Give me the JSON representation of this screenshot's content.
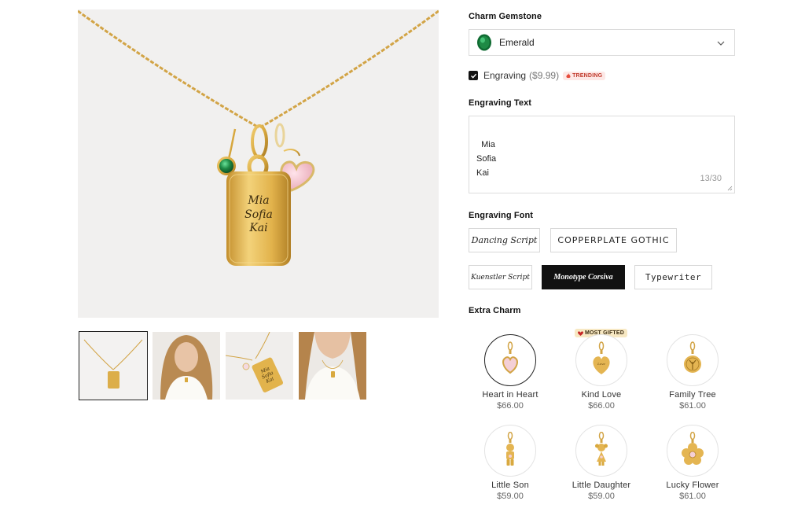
{
  "gallery": {
    "engraving_on_pendant": [
      "Mia",
      "Sofia",
      "Kai"
    ],
    "thumbnails": [
      {
        "name": "necklace-flat"
      },
      {
        "name": "model-wearing-1"
      },
      {
        "name": "necklace-angled"
      },
      {
        "name": "model-wearing-2"
      }
    ]
  },
  "gemstone": {
    "title": "Charm Gemstone",
    "selected": "Emerald",
    "gem_color": "#1e8a45"
  },
  "engraving_option": {
    "label": "Engraving",
    "price": "($9.99)",
    "badge": "TRENDING",
    "checked": true
  },
  "engraving_text": {
    "title": "Engraving Text",
    "value": "Mia\nSofia\nKai",
    "counter": "13/30"
  },
  "engraving_font": {
    "title": "Engraving Font",
    "options": [
      {
        "label": "Dancing Script",
        "selected": false
      },
      {
        "label": "COPPERPLATE GOTHIC",
        "selected": false
      },
      {
        "label": "Kuenstler Script",
        "selected": false
      },
      {
        "label": "Monotype Corsiva",
        "selected": true
      },
      {
        "label": "Typewriter",
        "selected": false
      }
    ]
  },
  "extra_charm": {
    "title": "Extra Charm",
    "badge": "MOST GIFTED",
    "items": [
      {
        "name": "Heart in Heart",
        "price": "$66.00",
        "selected": true
      },
      {
        "name": "Kind Love",
        "price": "$66.00",
        "selected": false
      },
      {
        "name": "Family Tree",
        "price": "$61.00",
        "selected": false
      },
      {
        "name": "Little Son",
        "price": "$59.00",
        "selected": false
      },
      {
        "name": "Little Daughter",
        "price": "$59.00",
        "selected": false
      },
      {
        "name": "Lucky Flower",
        "price": "$61.00",
        "selected": false
      }
    ]
  },
  "colors": {
    "gold": "#d9a93f",
    "gold_dark": "#b8862a",
    "accent": "#111111"
  }
}
